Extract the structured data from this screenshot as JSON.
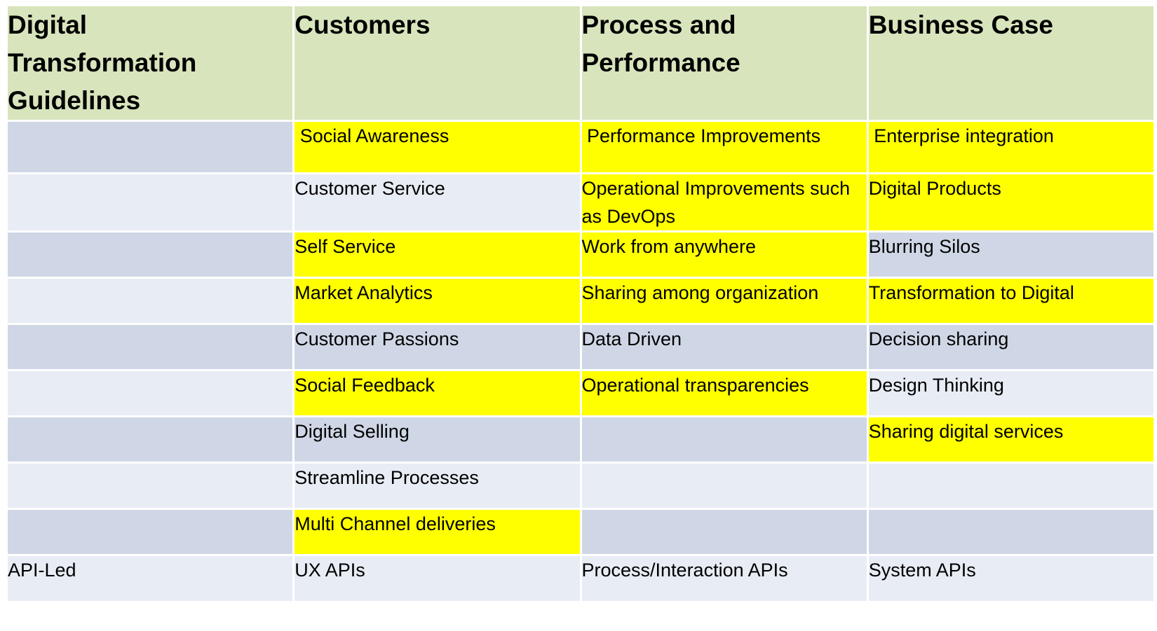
{
  "header": {
    "title": "Digital Transformation Guidelines",
    "title_lines": [
      "Digital",
      "Transformation",
      "Guidelines"
    ],
    "columns": [
      "Customers",
      "Process and Performance",
      "Business Case"
    ]
  },
  "colors": {
    "header_bg": "#d8e4bc",
    "band_dark": "#cfd7e6",
    "band_light": "#e8ecf4",
    "highlight": "#ffff00"
  },
  "rows": [
    {
      "label": "",
      "cells": [
        {
          "text": " Social Awareness",
          "highlight": true
        },
        {
          "text": " Performance Improvements",
          "highlight": true
        },
        {
          "text": " Enterprise integration",
          "highlight": true
        }
      ]
    },
    {
      "label": "",
      "cells": [
        {
          "text": "Customer Service",
          "highlight": false
        },
        {
          "text": "Operational Improvements such as DevOps",
          "highlight": true
        },
        {
          "text": "Digital Products",
          "highlight": true
        }
      ]
    },
    {
      "label": "",
      "cells": [
        {
          "text": "Self Service",
          "highlight": true
        },
        {
          "text": "Work from anywhere",
          "highlight": true
        },
        {
          "text": "Blurring Silos",
          "highlight": false
        }
      ]
    },
    {
      "label": "",
      "cells": [
        {
          "text": "Market Analytics",
          "highlight": true
        },
        {
          "text": "Sharing among organization",
          "highlight": true
        },
        {
          "text": "Transformation to Digital",
          "highlight": true
        }
      ]
    },
    {
      "label": "",
      "cells": [
        {
          "text": "Customer Passions",
          "highlight": false
        },
        {
          "text": "Data Driven",
          "highlight": false
        },
        {
          "text": "Decision sharing",
          "highlight": false
        }
      ]
    },
    {
      "label": "",
      "cells": [
        {
          "text": "Social Feedback",
          "highlight": true
        },
        {
          "text": "Operational transparencies",
          "highlight": true
        },
        {
          "text": "Design Thinking",
          "highlight": false
        }
      ]
    },
    {
      "label": "",
      "cells": [
        {
          "text": "Digital Selling",
          "highlight": false
        },
        {
          "text": "",
          "highlight": false
        },
        {
          "text": "Sharing digital services",
          "highlight": true
        }
      ]
    },
    {
      "label": "",
      "cells": [
        {
          "text": "Streamline Processes",
          "highlight": false
        },
        {
          "text": "",
          "highlight": false
        },
        {
          "text": "",
          "highlight": false
        }
      ]
    },
    {
      "label": "",
      "cells": [
        {
          "text": "Multi Channel deliveries",
          "highlight": true
        },
        {
          "text": "",
          "highlight": false
        },
        {
          "text": "",
          "highlight": false
        }
      ]
    },
    {
      "label": "API-Led",
      "cells": [
        {
          "text": "UX APIs",
          "highlight": false
        },
        {
          "text": "Process/Interaction APIs",
          "highlight": false
        },
        {
          "text": "System APIs",
          "highlight": false
        }
      ]
    }
  ]
}
